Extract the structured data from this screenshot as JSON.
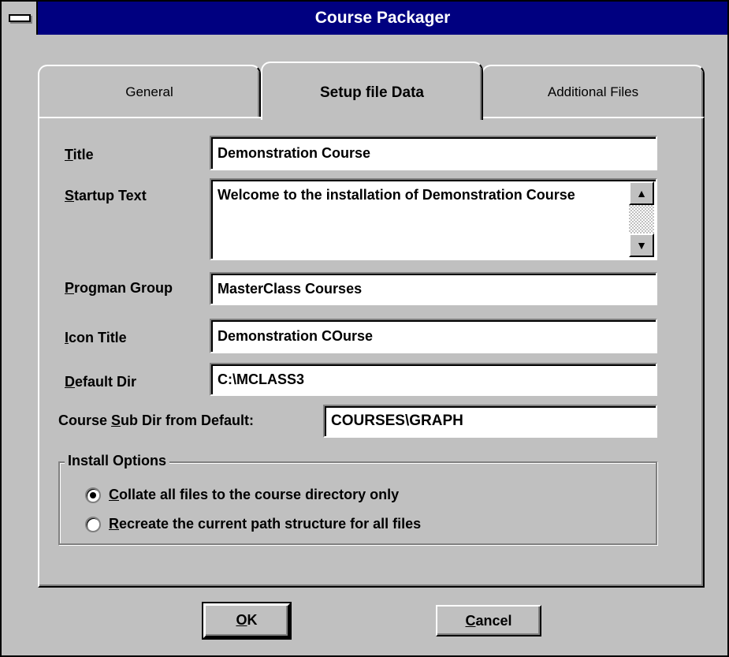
{
  "window": {
    "title": "Course Packager"
  },
  "tabs": [
    {
      "label": "General",
      "active": false
    },
    {
      "label": "Setup file Data",
      "active": true
    },
    {
      "label": "Additional Files",
      "active": false
    }
  ],
  "fields": {
    "title": {
      "label_mnemonic": "T",
      "label_rest": "itle",
      "value": "Demonstration Course"
    },
    "startup_text": {
      "label_mnemonic": "S",
      "label_rest": "tartup Text",
      "value": "Welcome to the installation of Demonstration Course"
    },
    "progman_group": {
      "label_mnemonic": "P",
      "label_rest": "rogman Group",
      "value": "MasterClass Courses"
    },
    "icon_title": {
      "label_mnemonic": "I",
      "label_rest": "con Title",
      "value": "Demonstration COurse"
    },
    "default_dir": {
      "label_mnemonic": "D",
      "label_rest": "efault Dir",
      "value": "C:\\MCLASS3"
    },
    "course_sub_dir": {
      "label_before": "Course ",
      "label_mnemonic": "S",
      "label_after": "ub Dir from Default:",
      "value": "COURSES\\GRAPH"
    }
  },
  "install_options": {
    "legend": "Install Options",
    "options": [
      {
        "mnemonic": "C",
        "rest": "ollate all files to the course directory only",
        "selected": true
      },
      {
        "mnemonic": "R",
        "rest": "ecreate the current path structure for all files",
        "selected": false
      }
    ]
  },
  "buttons": {
    "ok": {
      "mnemonic": "O",
      "rest": "K"
    },
    "cancel": {
      "mnemonic": "C",
      "rest": "ancel"
    }
  },
  "icons": {
    "system_menu": "system-menu-icon",
    "scroll_up": "up-arrow-icon",
    "scroll_down": "down-arrow-icon",
    "radio_selected": "radio-selected-icon",
    "radio_unselected": "radio-unselected-icon"
  },
  "colors": {
    "face": "#c0c0c0",
    "titlebar": "#000080",
    "titlebar_text": "#ffffff",
    "field_bg": "#ffffff",
    "shadow": "#808080",
    "highlight": "#ffffff"
  }
}
